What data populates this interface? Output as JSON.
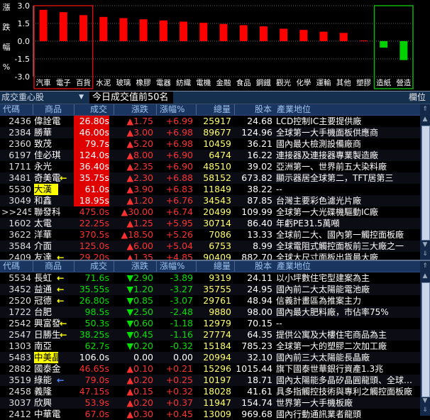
{
  "chart_data": {
    "type": "bar",
    "ylabel": "漲跌幅%",
    "ylim": [
      -3.0,
      3.0
    ],
    "ticks": [
      "3.0",
      "1.5",
      "0.0",
      "-1.5",
      "-3.0"
    ],
    "tick_values": [
      3.0,
      1.5,
      0.0,
      -1.5,
      -3.0
    ],
    "categories": [
      "汽車",
      "電子",
      "百貨",
      "水泥",
      "玻璃",
      "橡膠",
      "電器",
      "紡織",
      "電機",
      "金融",
      "食品",
      "鋼鐵",
      "觀光",
      "化學",
      "運輸",
      "其他",
      "塑膠",
      "造紙",
      "營造"
    ],
    "values": [
      2.65,
      2.45,
      2.2,
      2.05,
      1.95,
      1.85,
      1.75,
      1.65,
      1.55,
      1.45,
      1.35,
      1.25,
      1.05,
      0.95,
      0.8,
      0.7,
      0.05,
      -0.55,
      -1.6
    ],
    "colors": {
      "up": "#ff0000",
      "down": "#00d000"
    },
    "boxes": [
      {
        "from": "汽車",
        "to": "百貨",
        "color": "#d01010"
      },
      {
        "from": "造紙",
        "to": "營造",
        "color": "#10b010"
      }
    ]
  },
  "ylabel_chars": [
    "漲",
    "跌",
    "幅",
    "%"
  ],
  "top_section": {
    "selector": "成交重心股",
    "title": "今日成交值前50名",
    "right": "欄位",
    "headers": [
      "代碼",
      "商品",
      "成交",
      "漲跌",
      "漲幅%",
      "總量",
      "股本",
      "產業地位"
    ],
    "rows": [
      {
        "code": "2436",
        "name": "偉詮電",
        "price": "26.80s",
        "price_hl": "red",
        "chg": "▲1.75",
        "pct": "+6.99",
        "vol": "25917",
        "eps": "24.68",
        "ind": "LCD控制IC主要提供廠"
      },
      {
        "code": "2384",
        "name": "勝華",
        "price": "46.00s",
        "price_hl": "red",
        "chg": "▲3.00",
        "pct": "+6.98",
        "vol": "89677",
        "eps": "124.96",
        "ind": "全球第一大手機面板供應商"
      },
      {
        "code": "2360",
        "name": "致茂",
        "price": "79.7s",
        "price_hl": "red",
        "chg": "▲5.20",
        "pct": "+6.98",
        "vol": "10459",
        "eps": "36.21",
        "ind": "國內最大檢測設備廠商"
      },
      {
        "code": "6197",
        "name": "佳必琪",
        "price": "124.0s",
        "price_hl": "red",
        "chg": "▲8.00",
        "pct": "+6.90",
        "vol": "6474",
        "eps": "16.22",
        "ind": "連接器及連接器專業製造廠"
      },
      {
        "code": "1711",
        "name": "永光",
        "price": "36.40s",
        "price_hl": "red",
        "chg": "▲2.35",
        "pct": "+6.90",
        "vol": "48510",
        "eps": "39.02",
        "ind": "亞洲第一、世界前五大染料廠"
      },
      {
        "code": "3481",
        "name": "奇美電",
        "mark": "←",
        "mark_color": "yellow",
        "price": "35.75s",
        "price_hl": "red",
        "chg": "▲2.30",
        "pct": "+6.88",
        "vol": "58152",
        "eps": "673.82",
        "ind": "顯示器居全球第二，TFT居第三"
      },
      {
        "code": "5530",
        "name": "大漢",
        "name_hl": "yellow",
        "price": "61.0s",
        "price_hl": "red",
        "chg": "▲3.90",
        "pct": "+6.83",
        "vol": "11849",
        "eps": "38.22",
        "ind": "--"
      },
      {
        "code": "3049",
        "name": "和鑫",
        "price": "18.95s",
        "price_hl": "red",
        "chg": "▲1.20",
        "pct": "+6.76",
        "vol": "34543",
        "eps": "87.85",
        "ind": "台灣主要彩色濾光片廠"
      },
      {
        "code": ">>2454",
        "name": "聯發科",
        "price": "475.0s",
        "price_hl": "none",
        "chg": "▲30.00",
        "pct": "+6.74",
        "vol": "20499",
        "eps": "109.99",
        "ind": "全球第一大光碟機驅動IC廠"
      },
      {
        "code": "1602",
        "name": "太電",
        "price": "22.25s",
        "price_hl": "none",
        "chg": "▲1.25",
        "pct": "+5.95",
        "vol": "30714",
        "eps": "86.40",
        "ind": "年虧PE31.5萬噸"
      },
      {
        "code": "3622",
        "name": "洋華",
        "price": "370.5s",
        "price_hl": "none",
        "chg": "▲18.50",
        "pct": "+5.26",
        "vol": "7086",
        "eps": "13.33",
        "ind": "全球前二大、國內第一觸控面板廠"
      },
      {
        "code": "3584",
        "name": "介面",
        "price": "125.0s",
        "price_hl": "none",
        "chg": "▲6.00",
        "pct": "+5.04",
        "vol": "6753",
        "eps": "8.99",
        "ind": "全球電阻式觸控面板前三大廠之一"
      },
      {
        "code": "2409",
        "name": "友達",
        "mark": "←",
        "mark_color": "yellow",
        "price": "29.20s",
        "price_hl": "none",
        "chg": "▲1.35",
        "pct": "+4.85",
        "vol": "90409",
        "eps": "882.70",
        "ind": "全球大尺寸面板出貨最大廠"
      }
    ]
  },
  "bottom_section": {
    "headers": [
      "代碼",
      "商品",
      "成交",
      "漲跌",
      "漲幅%",
      "總量",
      "股本",
      "產業地位"
    ],
    "rows": [
      {
        "code": "5534",
        "name": "長虹",
        "mark": "←",
        "mark_color": "yellow",
        "price": "71.6s",
        "dir": "up",
        "chg": "▼2.90",
        "pct": "-3.89",
        "vol": "9319",
        "eps": "24.11",
        "ind": "以小坪數住宅型建案為主"
      },
      {
        "code": "3452",
        "name": "益通",
        "mark": "←",
        "mark_color": "yellow",
        "price": "35.55s",
        "dir": "up",
        "chg": "▼1.20",
        "pct": "-3.27",
        "vol": "35755",
        "eps": "24.95",
        "ind": "國內前二大太陽能電池廠"
      },
      {
        "code": "2520",
        "name": "冠德",
        "mark": "←",
        "mark_color": "yellow",
        "price": "26.80s",
        "dir": "up",
        "chg": "▼0.85",
        "pct": "-3.07",
        "vol": "29761",
        "eps": "48.94",
        "ind": "信義計畫區為推案主力"
      },
      {
        "code": "1722",
        "name": "台肥",
        "price": "98.5s",
        "dir": "up",
        "chg": "▼2.50",
        "pct": "-2.48",
        "vol": "9880",
        "eps": "98.00",
        "ind": "國內最大肥料廠，市佔率75%"
      },
      {
        "code": "2542",
        "name": "興富發",
        "mark": "←",
        "mark_color": "yellow",
        "price": "50.3s",
        "dir": "up",
        "chg": "▼0.60",
        "pct": "-1.18",
        "vol": "12979",
        "eps": "70.15",
        "ind": "--"
      },
      {
        "code": "2547",
        "name": "日勝生",
        "mark": "←",
        "mark_color": "yellow",
        "price": "38.25s",
        "dir": "up",
        "chg": "▼0.45",
        "pct": "-1.16",
        "vol": "27774",
        "eps": "64.35",
        "ind": "提供公寓及大樓住宅商品為主"
      },
      {
        "code": "1303",
        "name": "南亞",
        "price": "62.7s",
        "dir": "up",
        "chg": "▼0.20",
        "pct": "-0.32",
        "vol": "15184",
        "eps": "785.23",
        "ind": "全球第一大的塑膠二次加工廠"
      },
      {
        "code": "5483",
        "name": "中美晶",
        "name_hl": "yellow",
        "price": "106.0s",
        "dir": "flat",
        "chg": "0.00",
        "pct": "0.00",
        "vol": "20994",
        "eps": "32.10",
        "ind": "國內前三大太陽能長晶廠"
      },
      {
        "code": "2882",
        "name": "國泰金",
        "price": "46.65s",
        "dir": "down",
        "chg": "▲0.10",
        "pct": "+0.21",
        "vol": "15296",
        "eps": "1015.44",
        "ind": "旗下國泰世華銀行資產1.3兆"
      },
      {
        "code": "3519",
        "name": "綠能",
        "mark": "←",
        "mark_color": "blue",
        "price": "79.0s",
        "dir": "down",
        "chg": "▲0.20",
        "pct": "+0.25",
        "vol": "10197",
        "eps": "18.71",
        "ind": "國內太陽能多晶矽晶圓龍頭、全球…"
      },
      {
        "code": "2458",
        "name": "義隆",
        "price": "47.15s",
        "dir": "down",
        "chg": "▲0.15",
        "pct": "+0.32",
        "vol": "18028",
        "eps": "41.61",
        "ind": "具多指觸控技術與專利之觸控面板廠"
      },
      {
        "code": "3037",
        "name": "欣興",
        "price": "53.9s",
        "dir": "down",
        "chg": "▲0.20",
        "pct": "+0.37",
        "vol": "11947",
        "eps": "154.74",
        "ind": "世界第一大手機板廠"
      },
      {
        "code": "2412",
        "name": "中華電",
        "price": "67.0s",
        "dir": "down",
        "chg": "▲0.30",
        "pct": "+0.45",
        "vol": "13009",
        "eps": "969.68",
        "ind": "國內行動通訊業者龍頭"
      }
    ]
  }
}
